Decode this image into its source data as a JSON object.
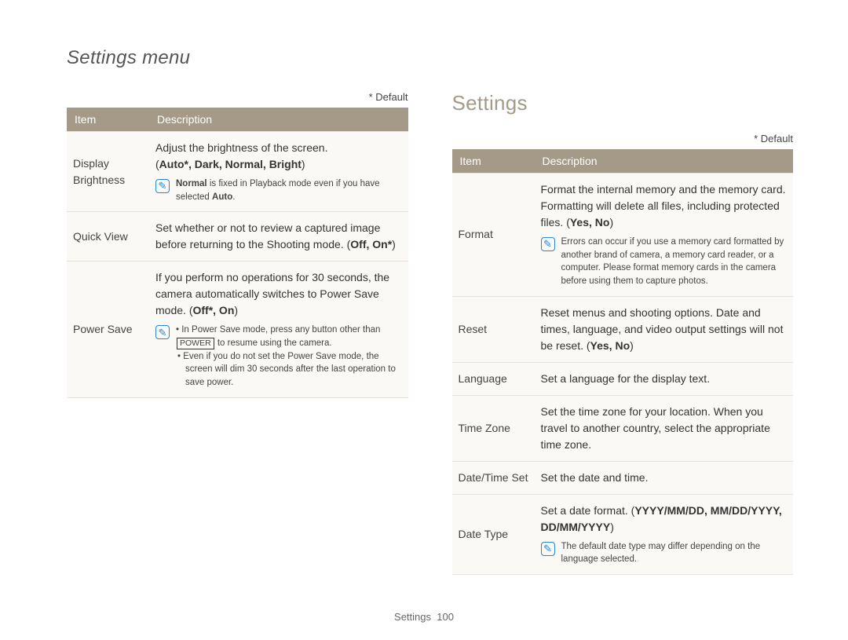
{
  "page": {
    "breadcrumb": "Settings menu",
    "section_heading": "Settings",
    "default_note": "* Default",
    "footer_label": "Settings",
    "footer_page": "100"
  },
  "table_headers": {
    "item": "Item",
    "description": "Description"
  },
  "left_rows": [
    {
      "item": "Display Brightness",
      "desc_intro": "Adjust the brightness of the screen.",
      "options_prefix": "(",
      "options_bold": "Auto*, Dark, Normal, Bright",
      "options_suffix": ")",
      "note_prefix": "Normal",
      "note_rest": " is fixed in Playback mode even if you have selected ",
      "note_trail": "Auto",
      "note_end": "."
    },
    {
      "item": "Quick View",
      "desc_intro": "Set whether or not to review a captured image before returning to the Shooting mode. ",
      "tail_open": "(",
      "tail_bold": "Off, On*",
      "tail_close": ")"
    },
    {
      "item": "Power Save",
      "desc_intro": "If you perform no operations for 30 seconds, the camera automatically switches to Power Save mode. ",
      "tail_open": "(",
      "tail_bold": "Off*, On",
      "tail_close": ")",
      "bullet1_a": "In Power Save mode, press any button other than ",
      "bullet1_key": "POWER",
      "bullet1_b": " to resume using the camera.",
      "bullet2": "Even if you do not set the Power Save mode, the screen will dim 30 seconds after the last operation to save power."
    }
  ],
  "right_rows": [
    {
      "item": "Format",
      "desc_intro": "Format the internal memory and the memory card. Formatting will delete all files, including protected files. ",
      "tail_open": "(",
      "tail_bold": "Yes, No",
      "tail_close": ")",
      "note": "Errors can occur if you use a memory card formatted by another brand of camera, a memory card reader, or a computer. Please format memory cards in the camera before using them to capture photos."
    },
    {
      "item": "Reset",
      "desc_intro": "Reset menus and shooting options. Date and times, language, and video output settings will not be reset. ",
      "tail_open": "(",
      "tail_bold": "Yes, No",
      "tail_close": ")"
    },
    {
      "item": "Language",
      "desc_intro": "Set a language for the display text."
    },
    {
      "item": "Time Zone",
      "desc_intro": "Set the time zone for your location. When you travel to another country, select the appropriate time zone."
    },
    {
      "item": "Date/Time Set",
      "desc_intro": "Set the date and time."
    },
    {
      "item": "Date Type",
      "desc_intro": "Set a date format. ",
      "tail_open": "(",
      "tail_bold": "YYYY/MM/DD, MM/DD/YYYY, DD/MM/YYYY",
      "tail_close": ")",
      "note": "The default date type may differ depending on the language selected."
    }
  ]
}
